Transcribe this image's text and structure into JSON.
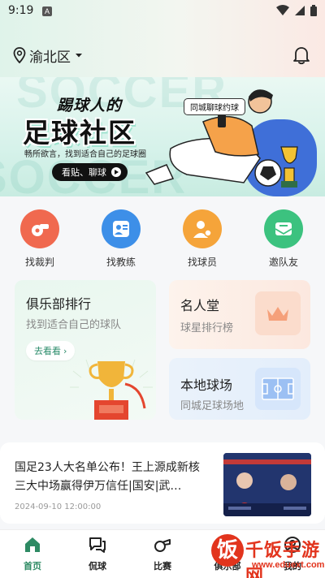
{
  "status": {
    "time": "9:19",
    "notif_badge": "A"
  },
  "header": {
    "location": "渝北区"
  },
  "banner": {
    "title_line1": "踢球人的",
    "title_line2": "足球社区",
    "subtitle": "畅所欲言，找到适合自己的足球圈",
    "button_label": "看贴、聊球",
    "tag": "同城聊球约球",
    "watermark": "SOCCER"
  },
  "quick_actions": [
    {
      "label": "找裁判",
      "icon": "whistle-icon",
      "color": "#f0694f"
    },
    {
      "label": "找教练",
      "icon": "coach-icon",
      "color": "#3d8fe8"
    },
    {
      "label": "找球员",
      "icon": "player-icon",
      "color": "#f5a43a"
    },
    {
      "label": "邀队友",
      "icon": "invite-icon",
      "color": "#3cc27f"
    }
  ],
  "cards": {
    "club": {
      "title": "俱乐部排行",
      "subtitle": "找到适合自己的球队",
      "button": "去看看"
    },
    "hall": {
      "title": "名人堂",
      "subtitle": "球星排行榜"
    },
    "field": {
      "title": "本地球场",
      "subtitle": "同城足球场地"
    }
  },
  "news": {
    "title": "国足23人大名单公布！王上源成新核 三大中场赢得伊万信任|国安|武…",
    "time": "2024-09-10 12:00:00"
  },
  "tabs": [
    {
      "label": "首页",
      "icon": "home-icon",
      "active": true
    },
    {
      "label": "侃球",
      "icon": "chat-icon",
      "active": false
    },
    {
      "label": "比赛",
      "icon": "whistle-icon",
      "active": false
    },
    {
      "label": "俱乐部",
      "icon": "flag-icon",
      "active": false
    },
    {
      "label": "我的",
      "icon": "profile-icon",
      "active": false
    }
  ],
  "watermark": {
    "logo": "饭",
    "text": "千饭手游网",
    "url": "www.eduext.com"
  },
  "colors": {
    "accent": "#2d8a63",
    "brand_red": "#e2341d"
  }
}
